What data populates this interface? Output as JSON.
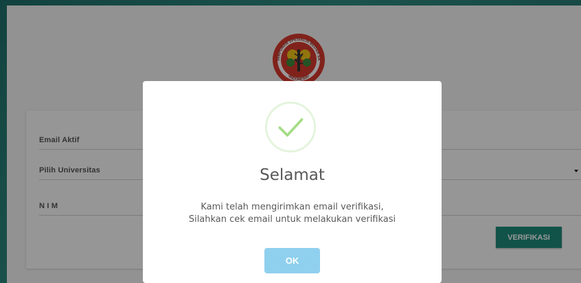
{
  "logo": {
    "icon": "organization-seal-logo",
    "text_top": "PERHIMPUNAN SPESIALIS BEDAH SARAF",
    "text_bottom": "INDONESIA"
  },
  "form": {
    "fields": [
      {
        "label": "Email Aktif",
        "value": ""
      },
      {
        "label": "Pilih Universitas",
        "value": ""
      },
      {
        "label": "N I M",
        "value": ""
      }
    ],
    "verify_label": "VERIFIKASI"
  },
  "modal": {
    "icon": "success-check-icon",
    "title": "Selamat",
    "message_line1": "Kami telah mengirimkan email verifikasi,",
    "message_line2": "Silahkan cek email untuk melakukan verifikasi",
    "ok_label": "OK"
  },
  "colors": {
    "primary": "#1e8a7a",
    "ok_button": "#8fd0ee",
    "success": "#a5dc86"
  }
}
